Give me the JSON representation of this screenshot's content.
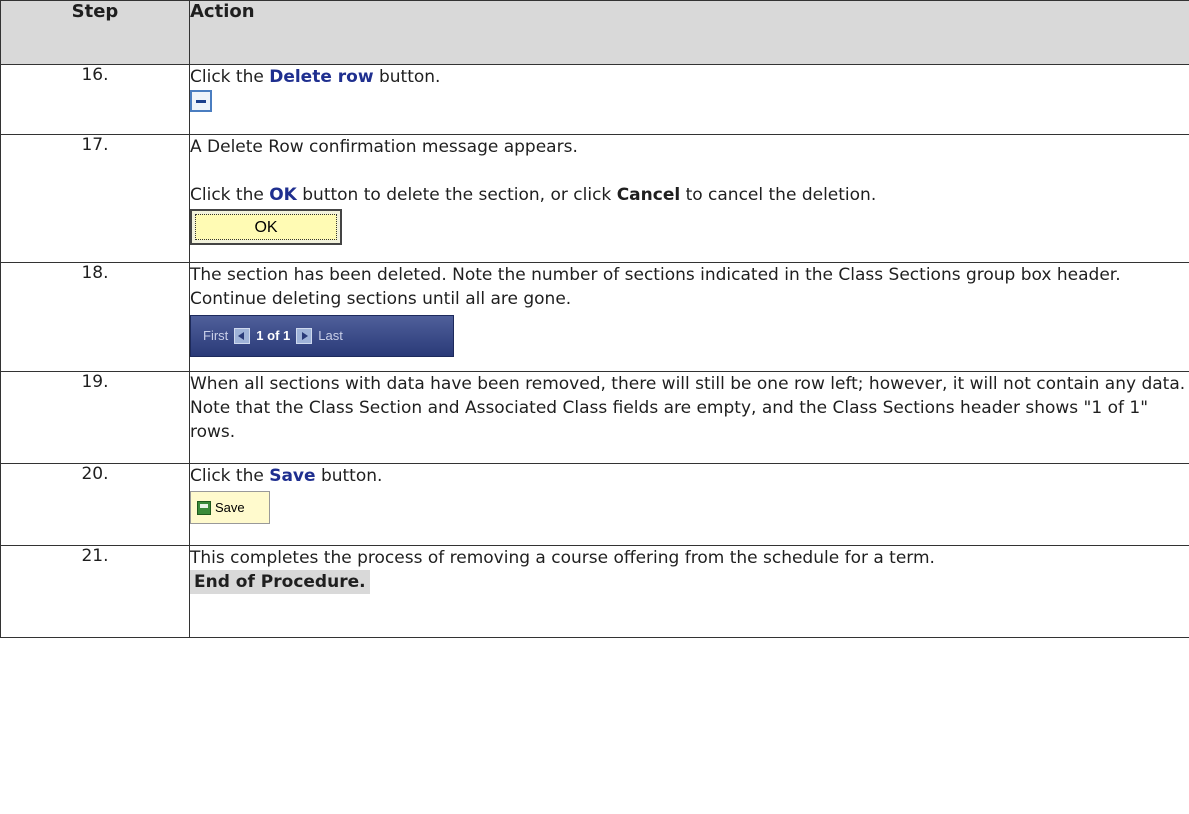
{
  "header": {
    "step": "Step",
    "action": "Action"
  },
  "rows": [
    {
      "num": "16.",
      "p1": "Click the ",
      "k1": "Delete row",
      "p2": " button."
    },
    {
      "num": "17.",
      "t1": "A Delete Row confirmation message appears.",
      "p1": "Click the ",
      "k1": "OK",
      "p2": " button to delete the section, or click ",
      "k2": "Cancel",
      "p3": " to cancel the deletion.",
      "ok_label": "OK"
    },
    {
      "num": "18.",
      "t1": "The section has been deleted.  Note the number of sections indicated in the Class Sections group box header.  Continue deleting sections until all are gone.",
      "nav_first": "First",
      "nav_count": "1 of 1",
      "nav_last": "Last"
    },
    {
      "num": "19.",
      "t1": "When all sections with data have been removed, there will still be one  row left; however, it will not contain any data.  Note that the Class Section and Associated Class fields are empty, and the Class Sections header shows \"1 of 1\" rows."
    },
    {
      "num": "20.",
      "p1": "Click the ",
      "k1": "Save",
      "p2": " button.",
      "save_label": "Save"
    },
    {
      "num": "21.",
      "t1": "This completes the process of removing a course offering from the schedule for a term.",
      "end": "End of Procedure."
    }
  ]
}
